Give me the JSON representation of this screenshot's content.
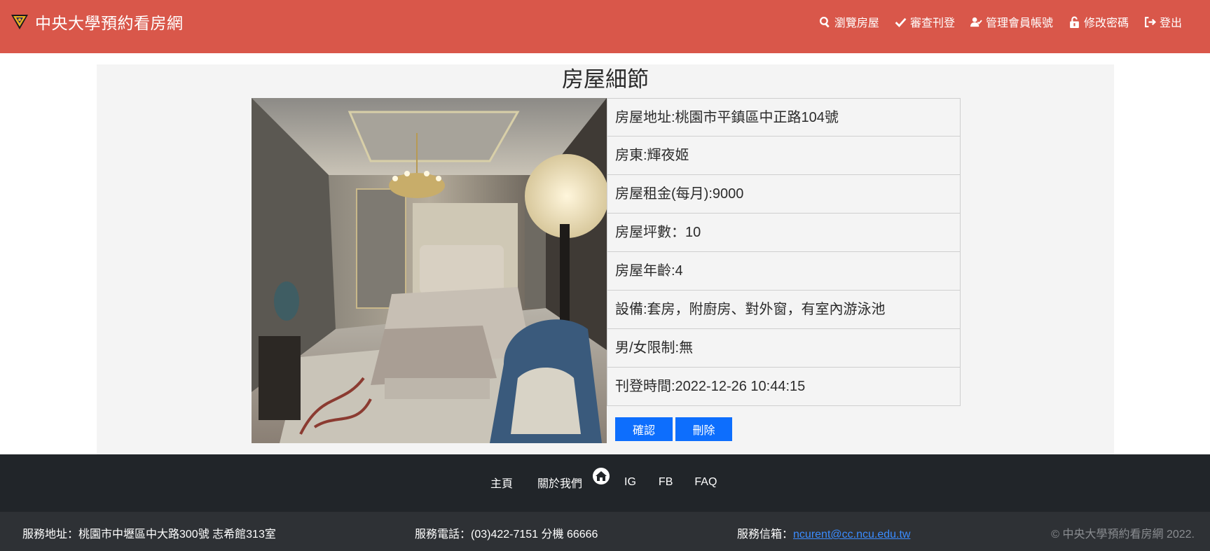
{
  "header": {
    "brand": "中央大學預約看房網",
    "nav": [
      {
        "label": "瀏覽房屋",
        "icon": "search-icon"
      },
      {
        "label": "審查刊登",
        "icon": "check-icon"
      },
      {
        "label": "管理會員帳號",
        "icon": "user-check-icon"
      },
      {
        "label": "修改密碼",
        "icon": "unlock-icon"
      },
      {
        "label": "登出",
        "icon": "sign-out-icon"
      }
    ],
    "bg_color": "#d9574a"
  },
  "main": {
    "title": "房屋細節",
    "details": [
      "房屋地址:桃園市平鎮區中正路104號",
      "房東:輝夜姬",
      "房屋租金(每月):9000",
      "房屋坪數：10",
      "房屋年齡:4",
      "設備:套房，附廚房、對外窗，有室內游泳池",
      "男/女限制:無",
      "刊登時間:2022-12-26 10:44:15"
    ],
    "buttons": {
      "confirm": "確認",
      "delete": "刪除"
    },
    "button_color": "#0d6efd"
  },
  "footer": {
    "links": {
      "home": "主頁",
      "about": "關於我們",
      "ig": "IG",
      "fb": "FB",
      "faq": "FAQ"
    },
    "address": "服務地址：桃園市中壢區中大路300號 志希館313室",
    "phone": "服務電話：(03)422-7151 分機 66666",
    "email_label": "服務信箱：",
    "email": "ncurent@cc.ncu.edu.tw",
    "copyright": "© 中央大學預約看房網 2022."
  }
}
